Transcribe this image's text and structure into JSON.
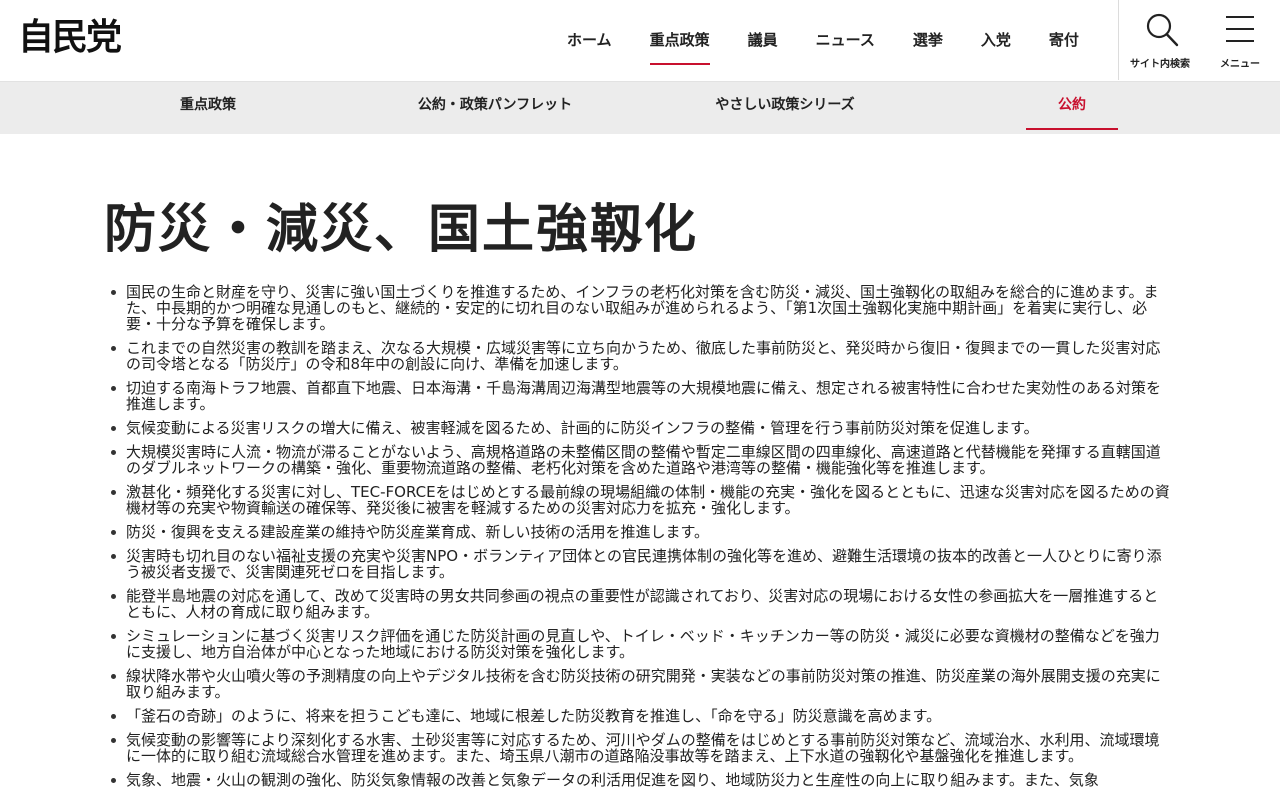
{
  "header": {
    "logo": "自民党",
    "nav": [
      {
        "label": "ホーム"
      },
      {
        "label": "重点政策",
        "active": true
      },
      {
        "label": "議員"
      },
      {
        "label": "ニュース"
      },
      {
        "label": "選挙"
      },
      {
        "label": "入党"
      },
      {
        "label": "寄付"
      }
    ],
    "search_label": "サイト内検索",
    "search_icon": "search-icon",
    "menu_label": "メニュー",
    "menu_icon": "hamburger-menu-icon"
  },
  "subnav": {
    "items": [
      {
        "label": "重点政策"
      },
      {
        "label": "公約・政策パンフレット"
      },
      {
        "label": "やさしい政策シリーズ"
      },
      {
        "label": "公約",
        "active": true
      }
    ]
  },
  "main": {
    "title": "防災・減災、国土強靱化",
    "items": [
      "国民の生命と財産を守り、災害に強い国土づくりを推進するため、インフラの老朽化対策を含む防災・減災、国土強靱化の取組みを総合的に進めます。また、中長期的かつ明確な見通しのもと、継続的・安定的に切れ目のない取組みが進められるよう、「第1次国土強靱化実施中期計画」を着実に実行し、必要・十分な予算を確保します。",
      "これまでの自然災害の教訓を踏まえ、次なる大規模・広域災害等に立ち向かうため、徹底した事前防災と、発災時から復旧・復興までの一貫した災害対応の司令塔となる「防災庁」の令和8年中の創設に向け、準備を加速します。",
      "切迫する南海トラフ地震、首都直下地震、日本海溝・千島海溝周辺海溝型地震等の大規模地震に備え、想定される被害特性に合わせた実効性のある対策を推進します。",
      "気候変動による災害リスクの増大に備え、被害軽減を図るため、計画的に防災インフラの整備・管理を行う事前防災対策を促進します。",
      "大規模災害時に人流・物流が滞ることがないよう、高規格道路の未整備区間の整備や暫定二車線区間の四車線化、高速道路と代替機能を発揮する直轄国道のダブルネットワークの構築・強化、重要物流道路の整備、老朽化対策を含めた道路や港湾等の整備・機能強化等を推進します。",
      "激甚化・頻発化する災害に対し、TEC-FORCEをはじめとする最前線の現場組織の体制・機能の充実・強化を図るとともに、迅速な災害対応を図るための資機材等の充実や物資輸送の確保等、発災後に被害を軽減するための災害対応力を拡充・強化します。",
      "防災・復興を支える建設産業の維持や防災産業育成、新しい技術の活用を推進します。",
      "災害時も切れ目のない福祉支援の充実や災害NPO・ボランティア団体との官民連携体制の強化等を進め、避難生活環境の抜本的改善と一人ひとりに寄り添う被災者支援で、災害関連死ゼロを目指します。",
      "能登半島地震の対応を通して、改めて災害時の男女共同参画の視点の重要性が認識されており、災害対応の現場における女性の参画拡大を一層推進するとともに、人材の育成に取り組みます。",
      "シミュレーションに基づく災害リスク評価を通じた防災計画の見直しや、トイレ・ベッド・キッチンカー等の防災・減災に必要な資機材の整備などを強力に支援し、地方自治体が中心となった地域における防災対策を強化します。",
      "線状降水帯や火山噴火等の予測精度の向上やデジタル技術を含む防災技術の研究開発・実装などの事前防災対策の推進、防災産業の海外展開支援の充実に取り組みます。",
      "「釜石の奇跡」のように、将来を担うこども達に、地域に根差した防災教育を推進し、「命を守る」防災意識を高めます。",
      "気候変動の影響等により深刻化する水害、土砂災害等に対応するため、河川やダムの整備をはじめとする事前防災対策など、流域治水、水利用、流域環境に一体的に取り組む流域総合水管理を進めます。また、埼玉県八潮市の道路陥没事故等を踏まえ、上下水道の強靱化や基盤強化を推進します。",
      "気象、地震・火山の観測の強化、防災気象情報の改善と気象データの利活用促進を図り、地域防災力と生産性の向上に取り組みます。また、気象"
    ]
  }
}
